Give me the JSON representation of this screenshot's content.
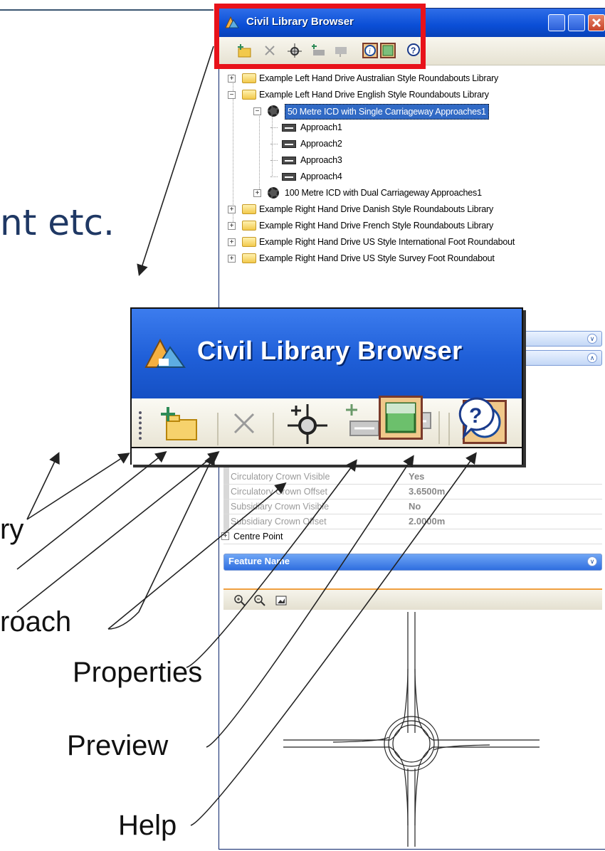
{
  "slide": {
    "partial_heading": "nt etc.",
    "callouts": {
      "library": "ry",
      "approach": "roach",
      "properties": "Properties",
      "preview": "Preview",
      "help": "Help"
    }
  },
  "window": {
    "title": "Civil Library Browser",
    "toolbar_icons": [
      "new-library-icon",
      "delete-icon",
      "new-roundabout-icon",
      "new-approach-icon",
      "approach-icon",
      "properties-icon",
      "preview-icon",
      "help-icon"
    ],
    "tree": [
      {
        "label": "Example Left Hand Drive Australian Style Roundabouts Library",
        "icon": "folder-icon"
      },
      {
        "label": "Example Left Hand Drive English Style Roundabouts Library",
        "icon": "folder-icon"
      },
      {
        "label": "50 Metre ICD with Single Carriageway Approaches1",
        "icon": "roundabout-icon",
        "selected": true
      },
      {
        "label": "Approach1",
        "icon": "approach-icon"
      },
      {
        "label": "Approach2",
        "icon": "approach-icon"
      },
      {
        "label": "Approach3",
        "icon": "approach-icon"
      },
      {
        "label": "Approach4",
        "icon": "approach-icon"
      },
      {
        "label": "100 Metre ICD with Dual Carriageway Approaches1",
        "icon": "roundabout-icon"
      },
      {
        "label": "Example Right Hand Drive Danish Style Roundabouts Library",
        "icon": "folder-icon"
      },
      {
        "label": "Example Right Hand Drive French Style Roundabouts Library",
        "icon": "folder-icon"
      },
      {
        "label": "Example Right Hand Drive US Style International Foot Roundabout",
        "icon": "folder-icon"
      },
      {
        "label": "Example Right Hand Drive US Style Survey Foot Roundabout",
        "icon": "folder-icon"
      }
    ],
    "properties": [
      {
        "key": "Circulatory Crown Visible",
        "value": "Yes"
      },
      {
        "key": "Circulatory Crown Offset",
        "value": "3.6500m"
      },
      {
        "key": "Subsidiary Crown Visible",
        "value": "No"
      },
      {
        "key": "Subsidiary Crown Offset",
        "value": "2.0000m"
      },
      {
        "key": "Centre Point",
        "value": ""
      }
    ],
    "feature_panel_label": "Feature Name",
    "preview_tools": [
      "zoom-in-icon",
      "zoom-out-icon",
      "fit-view-icon"
    ]
  },
  "zoom": {
    "title": "Civil Library Browser"
  },
  "colors": {
    "titlebar": "#0a4ed6",
    "highlight_box": "#e8121a",
    "heading_text": "#1f3864"
  }
}
